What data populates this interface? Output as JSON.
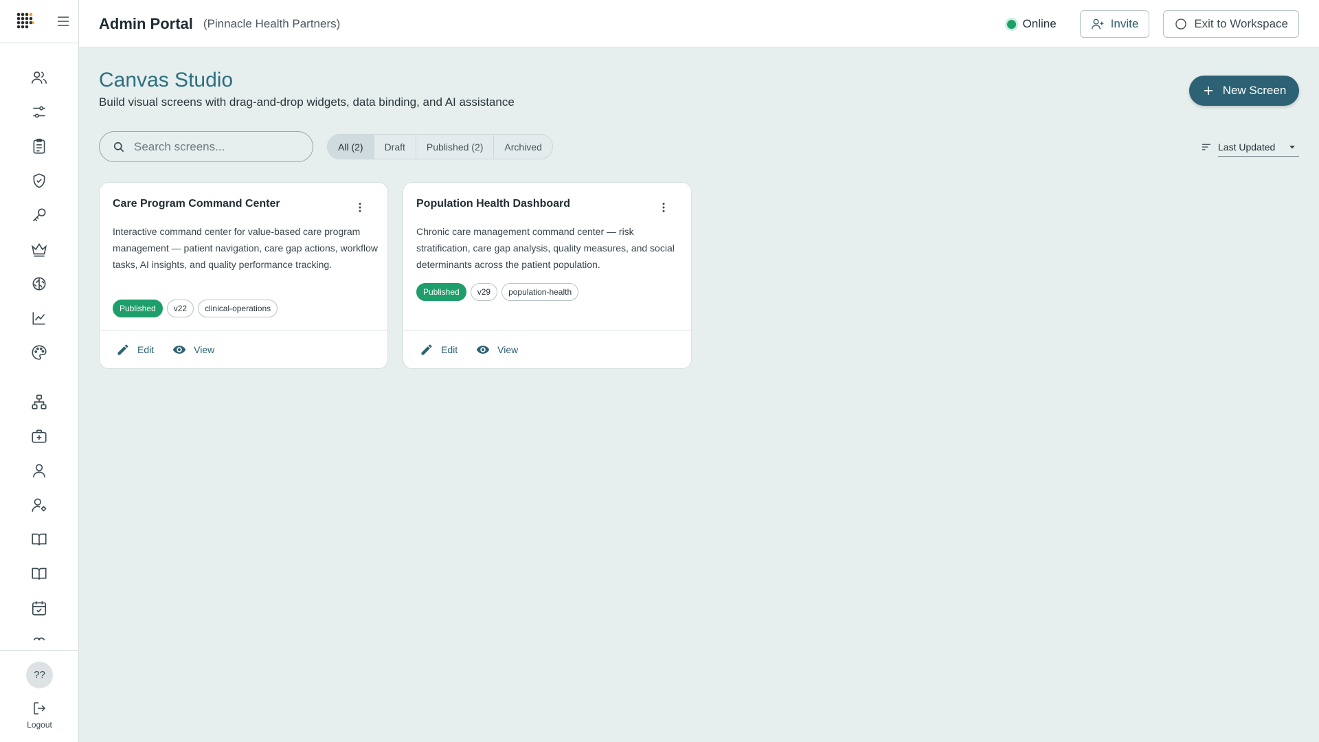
{
  "header": {
    "title": "Admin Portal",
    "org": "(Pinnacle Health Partners)",
    "status": "Online",
    "invite_label": "Invite",
    "exit_label": "Exit to Workspace"
  },
  "sidebar": {
    "items": [
      {
        "icon": "users-icon"
      },
      {
        "icon": "sliders-icon"
      },
      {
        "icon": "clipboard-icon"
      },
      {
        "icon": "shield-check-icon"
      },
      {
        "icon": "key-icon"
      },
      {
        "icon": "crown-icon"
      },
      {
        "icon": "brain-icon"
      },
      {
        "icon": "chart-line-icon"
      },
      {
        "icon": "palette-icon"
      },
      {
        "icon": "hierarchy-icon"
      },
      {
        "icon": "medical-kit-icon"
      },
      {
        "icon": "user-icon"
      },
      {
        "icon": "user-settings-icon"
      },
      {
        "icon": "book-open-icon"
      },
      {
        "icon": "book-icon"
      },
      {
        "icon": "calendar-check-icon"
      }
    ],
    "help_label": "??",
    "logout_label": "Logout"
  },
  "page": {
    "title": "Canvas Studio",
    "subtitle": "Build visual screens with drag-and-drop widgets, data binding, and AI assistance",
    "new_button": "New Screen"
  },
  "search": {
    "placeholder": "Search screens...",
    "value": ""
  },
  "filters": [
    {
      "label": "All (2)",
      "active": true
    },
    {
      "label": "Draft",
      "active": false
    },
    {
      "label": "Published (2)",
      "active": false
    },
    {
      "label": "Archived",
      "active": false
    }
  ],
  "sort": {
    "label": "Last Updated"
  },
  "cards": [
    {
      "title": "Care Program Command Center",
      "description": "Interactive command center for value-based care program management — patient navigation, care gap actions, workflow tasks, AI insights, and quality performance tracking.",
      "status": "Published",
      "version": "v22",
      "category": "clinical-operations",
      "edit_label": "Edit",
      "view_label": "View"
    },
    {
      "title": "Population Health Dashboard",
      "description": "Chronic care management command center — risk stratification, care gap analysis, quality measures, and social determinants across the patient population.",
      "status": "Published",
      "version": "v29",
      "category": "population-health",
      "edit_label": "Edit",
      "view_label": "View"
    }
  ],
  "colors": {
    "accent": "#2c6273",
    "title": "#2c6f80",
    "published": "#1e9e6a",
    "online": "#1e9e6a",
    "background": "#e6eeee"
  }
}
